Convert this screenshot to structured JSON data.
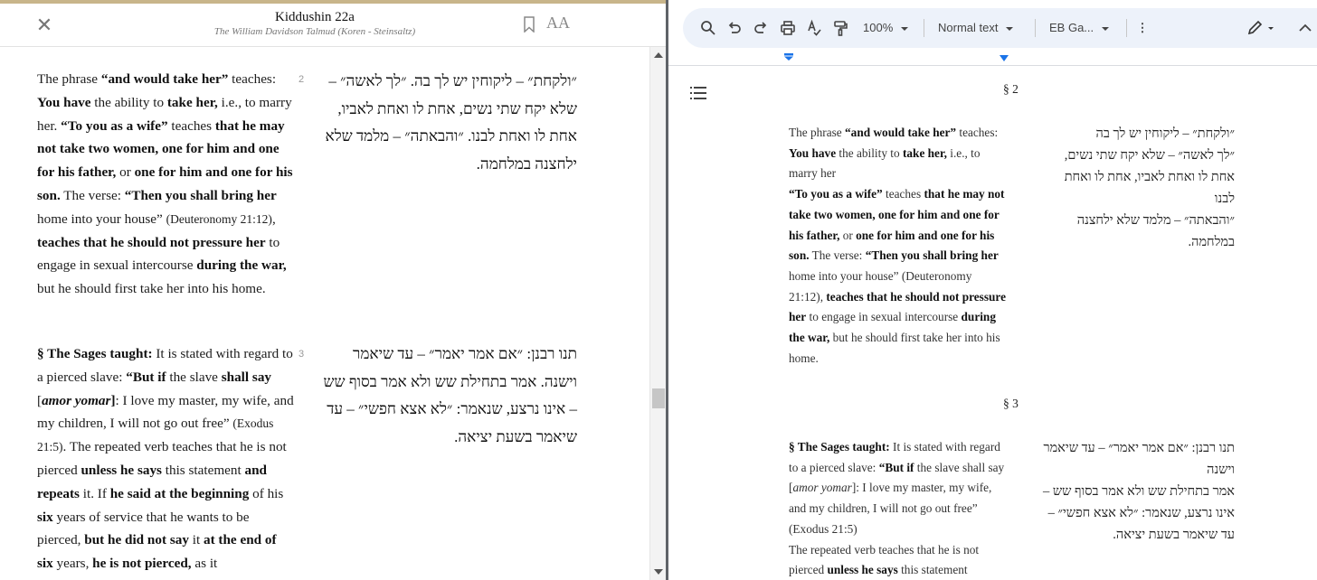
{
  "reader": {
    "title": "Kiddushin 22a",
    "subtitle": "The William Davidson Talmud (Koren - Steinsaltz)",
    "language_toggle": "AA",
    "segments": [
      {
        "number": "2",
        "en": [
          {
            "t": "The phrase "
          },
          {
            "t": "“and would take her”",
            "b": true
          },
          {
            "t": " teaches: "
          },
          {
            "t": "You have",
            "b": true
          },
          {
            "t": " the ability to "
          },
          {
            "t": "take her,",
            "b": true
          },
          {
            "t": " i.e., to marry her. "
          },
          {
            "t": "“To you as a wife”",
            "b": true
          },
          {
            "t": " teaches "
          },
          {
            "t": "that he may not take two women, one for him and one for his father,",
            "b": true
          },
          {
            "t": " or "
          },
          {
            "t": "one for him and one for his son.",
            "b": true
          },
          {
            "t": " The verse: "
          },
          {
            "t": "“Then you shall bring her",
            "b": true
          },
          {
            "t": " home into your house” "
          },
          {
            "t": "(Deuteronomy 21:12)",
            "src": true
          },
          {
            "t": ", "
          },
          {
            "t": "teaches that he should not pressure her",
            "b": true
          },
          {
            "t": " to engage in sexual intercourse "
          },
          {
            "t": "during the war,",
            "b": true
          },
          {
            "t": " but he should first take her into his home."
          }
        ],
        "he": "״ולקחת״ – ליקוחין יש לך בה. ״לך לאשה״ – שלא יקח שתי נשים, אחת לו ואחת לאביו, אחת לו ואחת לבנו. ״והבאתה״ – מלמד שלא ילחצנה במלחמה."
      },
      {
        "number": "3",
        "en": [
          {
            "t": "§ The Sages taught:",
            "b": true
          },
          {
            "t": " It is stated with regard to a pierced slave: "
          },
          {
            "t": "“But if",
            "b": true
          },
          {
            "t": " the slave "
          },
          {
            "t": "shall say",
            "b": true
          },
          {
            "t": " ["
          },
          {
            "t": "amor yomar",
            "i": true,
            "b": true
          },
          {
            "t": "]",
            "b": true
          },
          {
            "t": ": I love my master, my wife, and my children, I will not go out free” "
          },
          {
            "t": "(Exodus 21:5)",
            "src": true
          },
          {
            "t": ". The repeated verb teaches that he is not pierced "
          },
          {
            "t": "unless",
            "b": true
          },
          {
            "t": " "
          },
          {
            "t": "he says",
            "b": true
          },
          {
            "t": " this statement "
          },
          {
            "t": "and repeats",
            "b": true
          },
          {
            "t": " it. If "
          },
          {
            "t": "he said at the beginning",
            "b": true
          },
          {
            "t": " of his "
          },
          {
            "t": "six",
            "b": true
          },
          {
            "t": " years of service that he wants to be pierced, "
          },
          {
            "t": "but he did not say",
            "b": true
          },
          {
            "t": " it "
          },
          {
            "t": "at the end of six",
            "b": true
          },
          {
            "t": " years, "
          },
          {
            "t": "he is not pierced,",
            "b": true
          },
          {
            "t": " as it"
          }
        ],
        "he": "תנו רבנן: ״אם אמר יאמר״ – עד שיאמר וישנה. אמר בתחילת שש ולא אמר בסוף שש – אינו נרצע, שנאמר: ״לא אצא חפשי״ – עד שיאמר בשעת יציאה."
      }
    ]
  },
  "docs": {
    "toolbar": {
      "zoom": "100%",
      "style": "Normal text",
      "font": "EB Ga..."
    },
    "sections": [
      {
        "marker": "§ 2",
        "en": [
          {
            "t": "The phrase "
          },
          {
            "t": "“and would take her”",
            "b": true
          },
          {
            "t": " teaches: "
          },
          {
            "t": "You have",
            "b": true
          },
          {
            "t": " the ability to "
          },
          {
            "t": "take her,",
            "b": true
          },
          {
            "t": " i.e., to marry her",
            "br": true
          },
          {
            "t": "“To you as a wife”",
            "b": true
          },
          {
            "t": " teaches "
          },
          {
            "t": "that he may not take two women, one for him and one for his father,",
            "b": true
          },
          {
            "t": " or "
          },
          {
            "t": "one for him and one for his son.",
            "b": true
          },
          {
            "t": " The verse: "
          },
          {
            "t": "“Then you shall bring her",
            "b": true
          },
          {
            "t": " home into your house” (Deuteronomy 21:12), "
          },
          {
            "t": "teaches that he should not pressure her",
            "b": true
          },
          {
            "t": " to engage in sexual intercourse "
          },
          {
            "t": "during the war,",
            "b": true
          },
          {
            "t": " but he should first take her into his home."
          }
        ],
        "he_lines": [
          "״ולקחת״ – ליקוחין יש לך בה",
          "״לך לאשה״ – שלא יקח שתי נשים,",
          "אחת לו ואחת לאביו, אחת לו ואחת",
          "לבנו",
          "״והבאתה״ – מלמד שלא ילחצנה",
          "במלחמה."
        ]
      },
      {
        "marker": "§ 3",
        "en": [
          {
            "t": "§ The Sages taught:",
            "b": true
          },
          {
            "t": " It is stated with regard to a pierced slave: "
          },
          {
            "t": "“But if",
            "b": true
          },
          {
            "t": " the slave shall say ["
          },
          {
            "t": "amor yomar",
            "i": true
          },
          {
            "t": "]: I love my master, my wife, and my children, I will not go out free” (Exodus 21:5)",
            "br": true
          },
          {
            "t": "The repeated verb teaches that he is not pierced "
          },
          {
            "t": "unless he says",
            "b": true
          },
          {
            "t": " this statement"
          }
        ],
        "he_lines": [
          "תנו רבנן: ״אם אמר יאמר״ – עד שיאמר",
          "וישנה",
          "אמר בתחילת שש ולא אמר בסוף שש –",
          "אינו נרצע, שנאמר: ״לא אצא חפשי״ –",
          "עד שיאמר בשעת יציאה."
        ]
      }
    ]
  }
}
